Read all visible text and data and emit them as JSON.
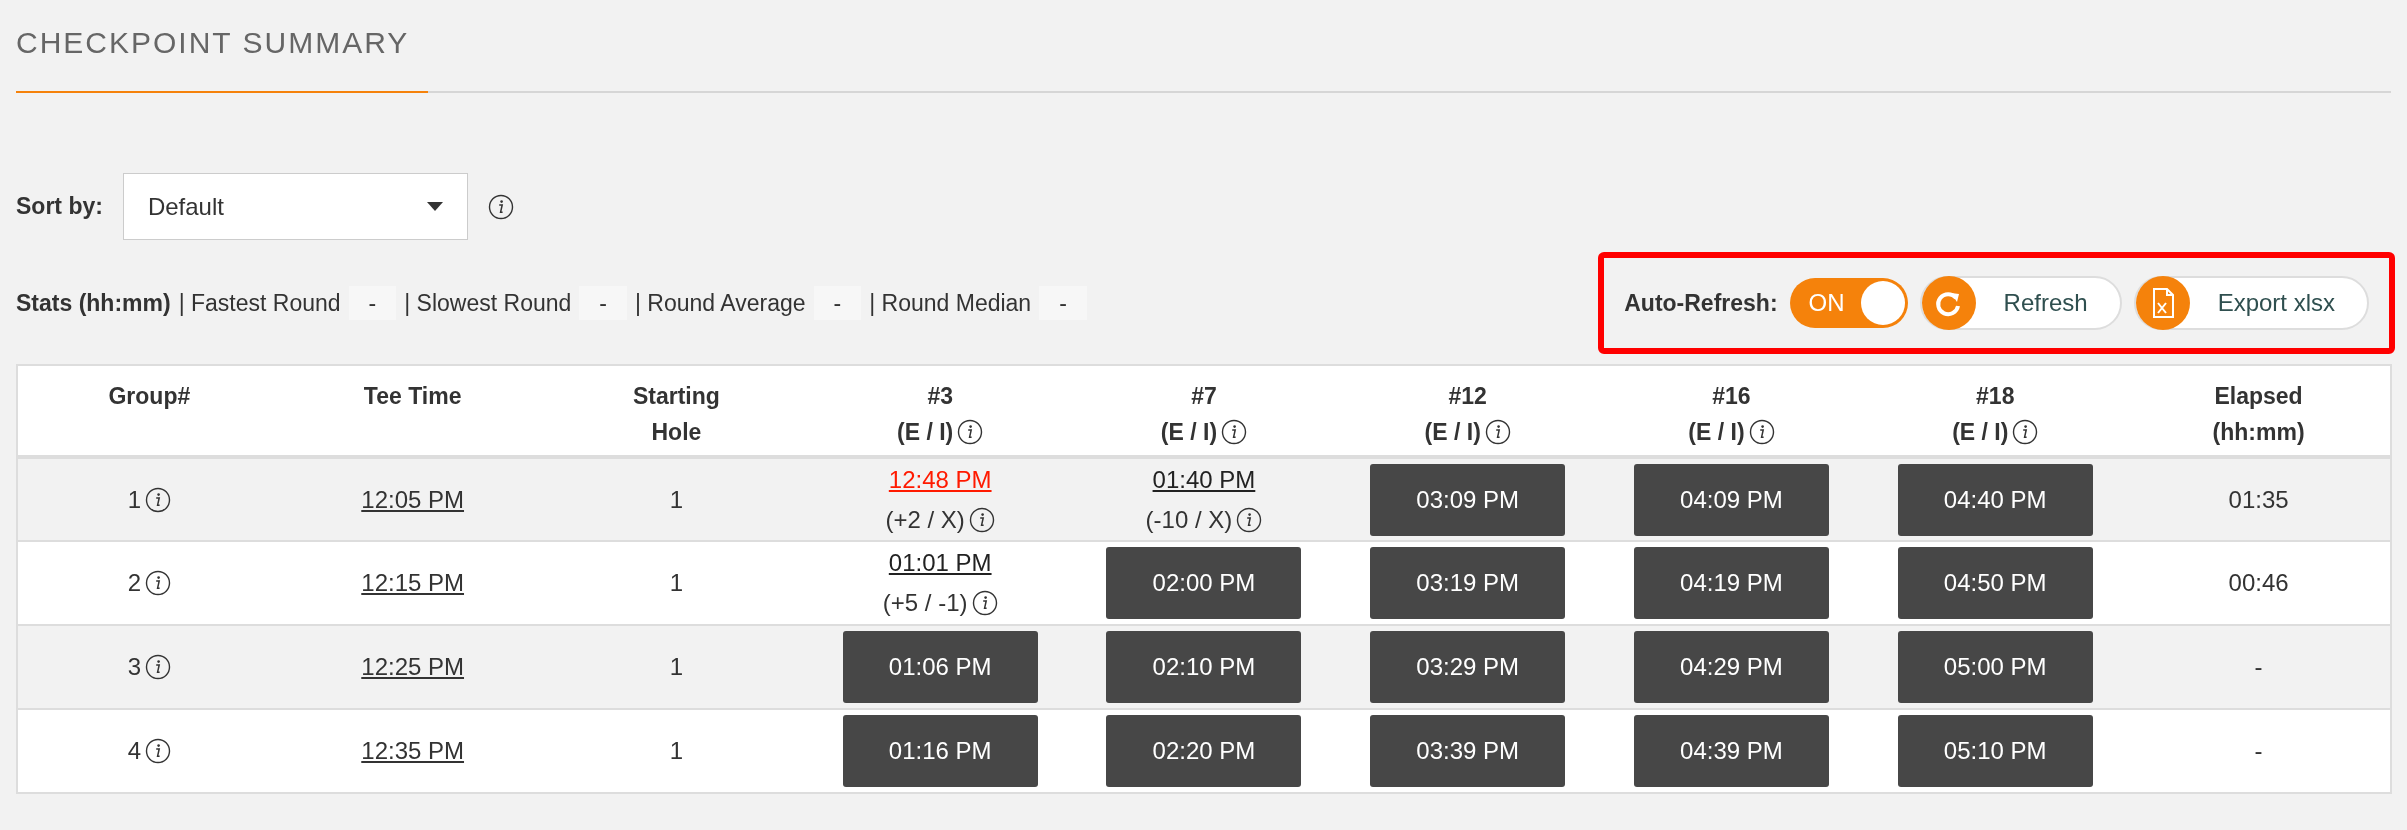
{
  "title": "CHECKPOINT SUMMARY",
  "sort": {
    "label": "Sort by:",
    "value": "Default"
  },
  "stats": {
    "label": "Stats (hh:mm)",
    "items": [
      {
        "label": "| Fastest Round",
        "value": "-"
      },
      {
        "label": "| Slowest Round",
        "value": "-"
      },
      {
        "label": "| Round Average",
        "value": "-"
      },
      {
        "label": "| Round Median",
        "value": "-"
      }
    ]
  },
  "controls": {
    "highlighted": true,
    "auto_refresh": {
      "label": "Auto-Refresh:",
      "on": true,
      "text": "ON"
    },
    "buttons": [
      {
        "kind": "refresh",
        "label": "Refresh"
      },
      {
        "kind": "export",
        "label": "Export xlsx"
      }
    ]
  },
  "table": {
    "columns": [
      {
        "kind": "plain",
        "lines": [
          "Group#"
        ]
      },
      {
        "kind": "plain",
        "lines": [
          "Tee Time"
        ]
      },
      {
        "kind": "plain",
        "lines": [
          "Starting",
          "Hole"
        ]
      },
      {
        "kind": "checkpoint",
        "lines": [
          "#3",
          "(E / I)"
        ]
      },
      {
        "kind": "checkpoint",
        "lines": [
          "#7",
          "(E / I)"
        ]
      },
      {
        "kind": "checkpoint",
        "lines": [
          "#12",
          "(E / I)"
        ]
      },
      {
        "kind": "checkpoint",
        "lines": [
          "#16",
          "(E / I)"
        ]
      },
      {
        "kind": "checkpoint",
        "lines": [
          "#18",
          "(E / I)"
        ]
      },
      {
        "kind": "plain",
        "lines": [
          "Elapsed",
          "(hh:mm)"
        ]
      }
    ],
    "rows": [
      {
        "group": "1",
        "tee_time": "12:05 PM",
        "starting_hole": "1",
        "checkpoints": [
          {
            "kind": "actual",
            "time": "12:48 PM",
            "late": true,
            "delta": "(+2 / X)"
          },
          {
            "kind": "actual",
            "time": "01:40 PM",
            "late": false,
            "delta": "(-10 / X)"
          },
          {
            "kind": "projected",
            "time": "03:09 PM"
          },
          {
            "kind": "projected",
            "time": "04:09 PM"
          },
          {
            "kind": "projected",
            "time": "04:40 PM"
          }
        ],
        "elapsed": "01:35"
      },
      {
        "group": "2",
        "tee_time": "12:15 PM",
        "starting_hole": "1",
        "checkpoints": [
          {
            "kind": "actual",
            "time": "01:01 PM",
            "late": false,
            "delta": "(+5 / -1)"
          },
          {
            "kind": "projected",
            "time": "02:00 PM"
          },
          {
            "kind": "projected",
            "time": "03:19 PM"
          },
          {
            "kind": "projected",
            "time": "04:19 PM"
          },
          {
            "kind": "projected",
            "time": "04:50 PM"
          }
        ],
        "elapsed": "00:46"
      },
      {
        "group": "3",
        "tee_time": "12:25 PM",
        "starting_hole": "1",
        "checkpoints": [
          {
            "kind": "projected",
            "time": "01:06 PM"
          },
          {
            "kind": "projected",
            "time": "02:10 PM"
          },
          {
            "kind": "projected",
            "time": "03:29 PM"
          },
          {
            "kind": "projected",
            "time": "04:29 PM"
          },
          {
            "kind": "projected",
            "time": "05:00 PM"
          }
        ],
        "elapsed": "-"
      },
      {
        "group": "4",
        "tee_time": "12:35 PM",
        "starting_hole": "1",
        "checkpoints": [
          {
            "kind": "projected",
            "time": "01:16 PM"
          },
          {
            "kind": "projected",
            "time": "02:20 PM"
          },
          {
            "kind": "projected",
            "time": "03:39 PM"
          },
          {
            "kind": "projected",
            "time": "04:39 PM"
          },
          {
            "kind": "projected",
            "time": "05:10 PM"
          }
        ],
        "elapsed": "-"
      }
    ]
  }
}
